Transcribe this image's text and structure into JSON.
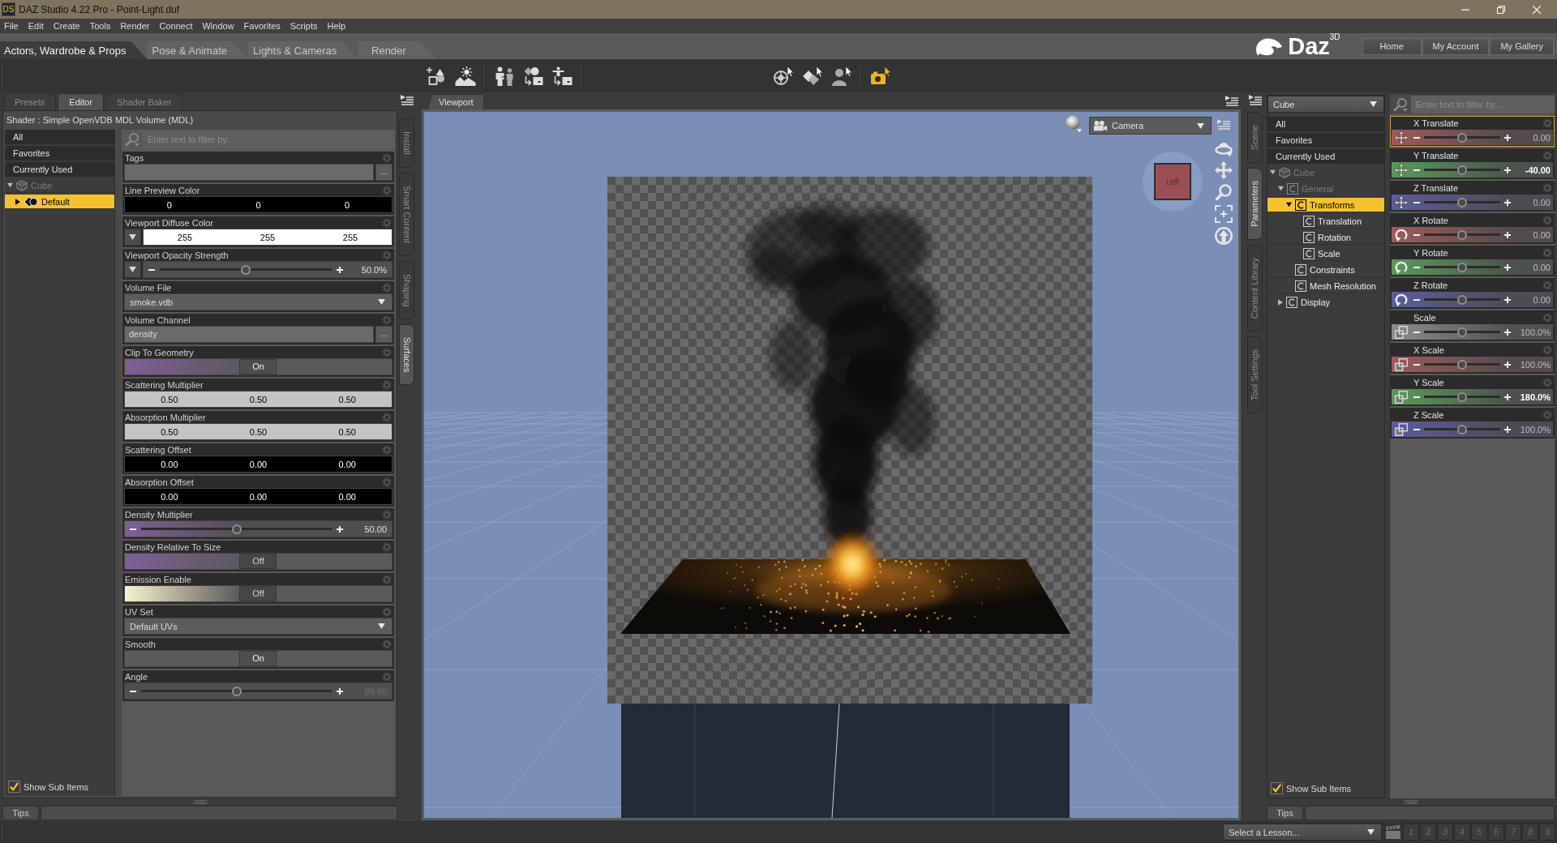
{
  "window": {
    "app_badge": "DS",
    "title": "DAZ Studio 4.22 Pro - Point-Light.duf"
  },
  "menu": [
    "File",
    "Edit",
    "Create",
    "Tools",
    "Render",
    "Connect",
    "Window",
    "Favorites",
    "Scripts",
    "Help"
  ],
  "rooms": [
    {
      "label": "Actors, Wardrobe & Props",
      "selected": true
    },
    {
      "label": "Pose & Animate",
      "selected": false
    },
    {
      "label": "Lights & Cameras",
      "selected": false
    },
    {
      "label": "Render",
      "selected": false
    }
  ],
  "brand": {
    "logo": "Daz$^{3D}$",
    "buttons": [
      "Home",
      "My Account",
      "My Gallery"
    ]
  },
  "surfaces_pane": {
    "tabs": [
      {
        "label": "Presets",
        "selected": false
      },
      {
        "label": "Editor",
        "selected": true
      },
      {
        "label": "Shader Baker",
        "selected": false
      }
    ],
    "shader": "Shader : Simple OpenVDB MDL Volume (MDL)",
    "filters": [
      "All",
      "Favorites",
      "Currently Used"
    ],
    "tree": [
      {
        "label": "Cube",
        "kind": "object",
        "dimmed": true,
        "selected": false,
        "expanded": true,
        "children": [
          {
            "label": "Default",
            "kind": "surface",
            "dimmed": false,
            "selected": true,
            "expanded": false
          }
        ]
      }
    ],
    "show_sub_items": {
      "label": "Show Sub Items",
      "checked": true
    },
    "filter_placeholder": "Enter text to filter by...",
    "properties": [
      {
        "kind": "text",
        "label": "Tags",
        "button": "..."
      },
      {
        "kind": "color",
        "label": "Line Preview Color",
        "expandable": false,
        "color": "#000000",
        "values": [
          "0",
          "0",
          "0"
        ]
      },
      {
        "kind": "color",
        "label": "Viewport Diffuse Color",
        "expandable": true,
        "color": "#ffffff",
        "values": [
          "255",
          "255",
          "255"
        ]
      },
      {
        "kind": "slider",
        "label": "Viewport Opacity Strength",
        "expandable": true,
        "level": 0.5,
        "reading": "50.0%",
        "disabled": false
      },
      {
        "kind": "select",
        "label": "Volume File",
        "value": "smoke.vdb"
      },
      {
        "kind": "text",
        "label": "Volume Channel",
        "value": "density",
        "button": "..."
      },
      {
        "kind": "toggle",
        "label": "Clip To Geometry",
        "value": "On",
        "on": true,
        "color": "#7e5f98"
      },
      {
        "kind": "color",
        "label": "Scattering Multiplier",
        "expandable": false,
        "color": "#c4c4c4",
        "values": [
          "0.50",
          "0.50",
          "0.50"
        ]
      },
      {
        "kind": "color",
        "label": "Absorption Multiplier",
        "expandable": false,
        "color": "#c4c4c4",
        "values": [
          "0.50",
          "0.50",
          "0.50"
        ]
      },
      {
        "kind": "color",
        "label": "Scattering Offset",
        "expandable": false,
        "color": "#000000",
        "values": [
          "0.00",
          "0.00",
          "0.00"
        ]
      },
      {
        "kind": "color",
        "label": "Absorption Offset",
        "expandable": false,
        "color": "#000000",
        "values": [
          "0.00",
          "0.00",
          "0.00"
        ]
      },
      {
        "kind": "slider",
        "label": "Density Multiplier",
        "expandable": false,
        "level": 0.5,
        "reading": "50.00",
        "disabled": false,
        "color": "#7e5f98"
      },
      {
        "kind": "toggle",
        "label": "Density Relative To Size",
        "value": "Off",
        "on": false,
        "color": "#7e5f98"
      },
      {
        "kind": "toggle",
        "label": "Emission Enable",
        "value": "Off",
        "on": false,
        "color": "#f6f4cc"
      },
      {
        "kind": "select",
        "label": "UV Set",
        "value": "Default UVs"
      },
      {
        "kind": "toggle",
        "label": "Smooth",
        "value": "On",
        "on": true
      },
      {
        "kind": "slider",
        "label": "Angle",
        "expandable": false,
        "level": 0.5,
        "reading": "89.90",
        "disabled": true
      }
    ],
    "tips": "Tips"
  },
  "left_side_tabs": [
    {
      "label": "Install",
      "selected": false
    },
    {
      "label": "Smart Content",
      "selected": false
    },
    {
      "label": "Shaping",
      "selected": false
    },
    {
      "label": "Surfaces",
      "selected": true
    }
  ],
  "viewport": {
    "tab": "Viewport",
    "camera": "Camera",
    "view_cube": "Left"
  },
  "right_side_tabs": [
    {
      "label": "Scene",
      "selected": false
    },
    {
      "label": "Parameters",
      "selected": true
    },
    {
      "label": "Content Library",
      "selected": false
    },
    {
      "label": "Tool Settings",
      "selected": false
    }
  ],
  "right_pane": {
    "node": "Cube",
    "filters": [
      "All",
      "Favorites",
      "Currently Used"
    ],
    "tree": [
      {
        "label": "Cube",
        "kind": "object",
        "dimmed": true,
        "selected": false,
        "expanded": true,
        "children": [
          {
            "label": "General",
            "kind": "group",
            "dimmed": true,
            "selected": false,
            "expanded": true,
            "children": [
              {
                "label": "Transforms",
                "kind": "group",
                "dimmed": false,
                "selected": true,
                "expanded": true,
                "children": [
                  {
                    "label": "Translation",
                    "kind": "group",
                    "dimmed": false,
                    "selected": false
                  },
                  {
                    "label": "Rotation",
                    "kind": "group",
                    "dimmed": false,
                    "selected": false
                  },
                  {
                    "label": "Scale",
                    "kind": "group",
                    "dimmed": false,
                    "selected": false
                  }
                ]
              },
              {
                "label": "Constraints",
                "kind": "group",
                "dimmed": false,
                "selected": false
              },
              {
                "label": "Mesh Resolution",
                "kind": "group",
                "dimmed": false,
                "selected": false
              }
            ]
          },
          {
            "label": "Display",
            "kind": "group",
            "dimmed": false,
            "selected": false,
            "expanded": false
          }
        ]
      }
    ],
    "show_sub_items": {
      "label": "Show Sub Items",
      "checked": true
    },
    "filter_placeholder": "Enter text to filter by...",
    "parameters": [
      {
        "label": "X Translate",
        "kind": "translate",
        "color": "#a05a5a",
        "level": 0.5,
        "reading": "0.00",
        "selected": true,
        "modified": false
      },
      {
        "label": "Y Translate",
        "kind": "translate",
        "color": "#5a9a5a",
        "level": 0.5,
        "reading": "-40.00",
        "selected": false,
        "modified": true
      },
      {
        "label": "Z Translate",
        "kind": "translate",
        "color": "#5c5c9e",
        "level": 0.5,
        "reading": "0.00",
        "selected": false,
        "modified": false
      },
      {
        "label": "X Rotate",
        "kind": "rotate",
        "color": "#a05a5a",
        "level": 0.5,
        "reading": "0.00",
        "selected": false,
        "modified": false
      },
      {
        "label": "Y Rotate",
        "kind": "rotate",
        "color": "#5a9a5a",
        "level": 0.5,
        "reading": "0.00",
        "selected": false,
        "modified": false
      },
      {
        "label": "Z Rotate",
        "kind": "rotate",
        "color": "#5c5c9e",
        "level": 0.5,
        "reading": "0.00",
        "selected": false,
        "modified": false
      },
      {
        "label": "Scale",
        "kind": "scale",
        "color": "#8c8c8c",
        "level": 0.5,
        "reading": "100.0%",
        "selected": false,
        "modified": false
      },
      {
        "label": "X Scale",
        "kind": "scale",
        "color": "#a05a5a",
        "level": 0.5,
        "reading": "100.0%",
        "selected": false,
        "modified": false
      },
      {
        "label": "Y Scale",
        "kind": "scale",
        "color": "#5a9a5a",
        "level": 0.5,
        "reading": "180.0%",
        "selected": false,
        "modified": true
      },
      {
        "label": "Z Scale",
        "kind": "scale",
        "color": "#5c5c9e",
        "level": 0.5,
        "reading": "100.0%",
        "selected": false,
        "modified": false
      }
    ],
    "tips": "Tips"
  },
  "status_bar": {
    "lesson": "Select a Lesson...",
    "steps": [
      "1",
      "2",
      "3",
      "4",
      "5",
      "6",
      "7",
      "8",
      "9"
    ]
  }
}
